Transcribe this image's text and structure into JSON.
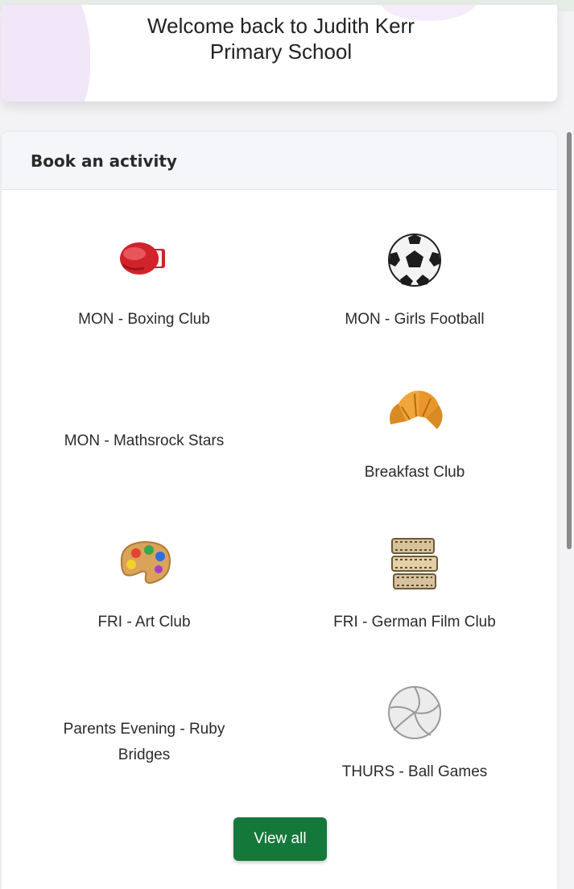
{
  "welcome": {
    "line1": "Welcome back to Judith Kerr",
    "line2": "Primary School"
  },
  "activities_card": {
    "title": "Book an activity",
    "view_all_label": "View all",
    "view_all_color": "#14783a",
    "items": [
      {
        "label": "MON - Boxing Club",
        "icon": "boxing-glove-icon"
      },
      {
        "label": "MON - Girls Football",
        "icon": "soccer-ball-icon"
      },
      {
        "label": "MON - Mathsrock Stars",
        "icon": ""
      },
      {
        "label": "Breakfast Club",
        "icon": "croissant-icon"
      },
      {
        "label": "FRI - Art Club",
        "icon": "art-palette-icon"
      },
      {
        "label": "FRI - German Film Club",
        "icon": "film-reel-icon"
      },
      {
        "label": "Parents Evening - Ruby Bridges",
        "icon": ""
      },
      {
        "label": "THURS - Ball Games",
        "icon": "volleyball-icon"
      }
    ]
  }
}
